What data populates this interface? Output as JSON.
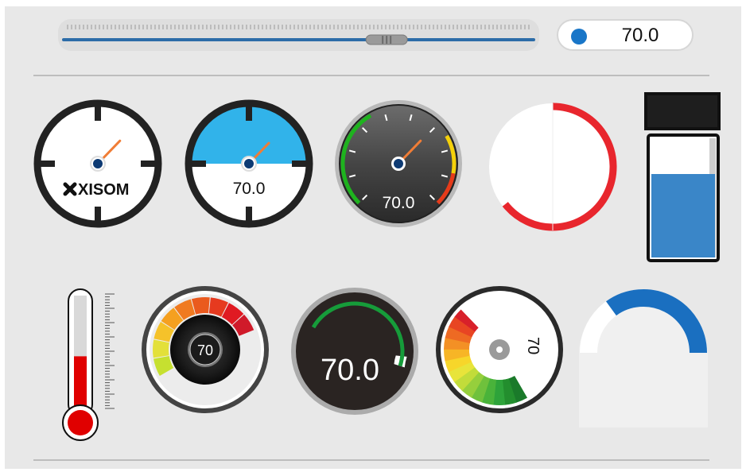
{
  "control": {
    "slider": {
      "value": 70.0,
      "min": 0,
      "max": 100
    },
    "readout": "70.0",
    "accent_color": "#1976c8"
  },
  "gauges": {
    "crosshair_logo": {
      "value": 70.0,
      "logo_text": "XISOM",
      "logo_icon": "x-mark-icon"
    },
    "crosshair_sky": {
      "value": 70.0,
      "label": "70.0"
    },
    "dark_dial": {
      "value": 70.0,
      "label": "70.0",
      "band_colors": [
        "#1eb31e",
        "#f5d10a",
        "#e63b1a"
      ]
    },
    "ring_arc": {
      "value": 70.0,
      "color": "#e8262d"
    },
    "battery": {
      "value": 70.0,
      "fill_color": "#3a86c8"
    },
    "thermometer": {
      "value": 70.0,
      "fill_color": "#e00000"
    },
    "segment_dial": {
      "value": 70.0,
      "label": "70"
    },
    "black_arc_dial": {
      "value": 70.0,
      "label": "70.0",
      "arc_color": "#169c3a"
    },
    "color_wheel": {
      "value": 70.0,
      "label": "70"
    },
    "arch_gauge": {
      "value": 70.0,
      "color": "#1a6fc0"
    }
  }
}
